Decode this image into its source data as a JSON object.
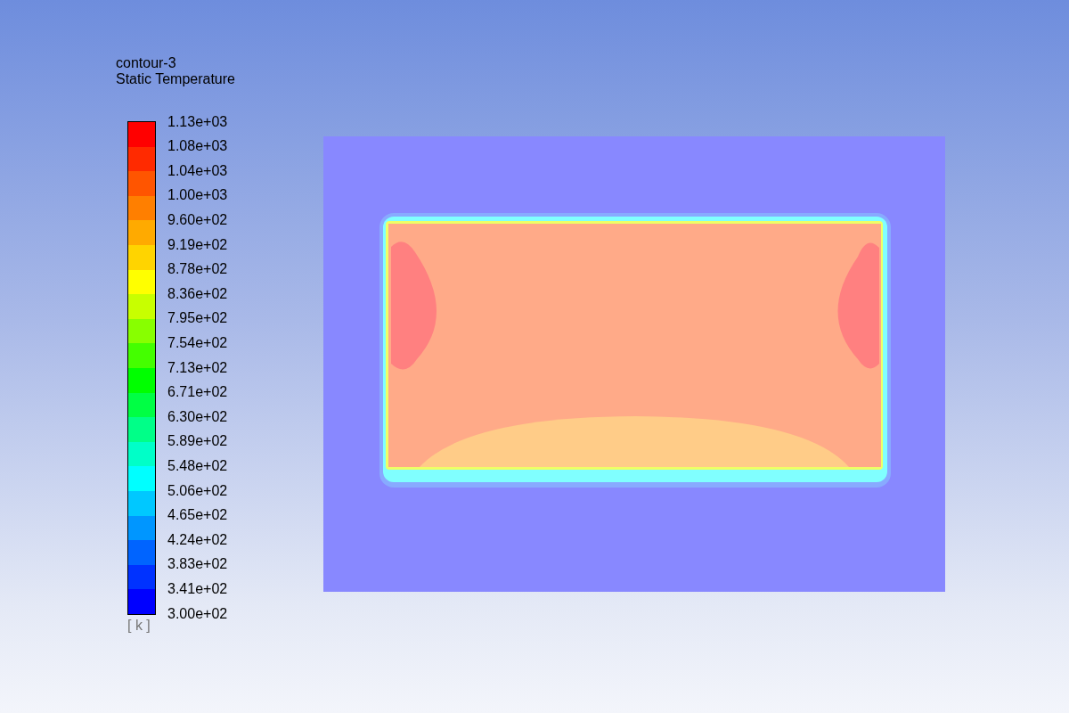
{
  "legend": {
    "title": "contour-3",
    "subtitle": "Static Temperature",
    "bands": [
      {
        "color": "#ff0000"
      },
      {
        "color": "#ff2a00"
      },
      {
        "color": "#ff5500"
      },
      {
        "color": "#ff7f00"
      },
      {
        "color": "#ffaa00"
      },
      {
        "color": "#ffd400"
      },
      {
        "color": "#ffff00"
      },
      {
        "color": "#c8ff00"
      },
      {
        "color": "#88ff00"
      },
      {
        "color": "#44ff00"
      },
      {
        "color": "#00ff00"
      },
      {
        "color": "#00ff44"
      },
      {
        "color": "#00ff88"
      },
      {
        "color": "#00ffc8"
      },
      {
        "color": "#00ffff"
      },
      {
        "color": "#00c8ff"
      },
      {
        "color": "#0096ff"
      },
      {
        "color": "#0064ff"
      },
      {
        "color": "#0032ff"
      },
      {
        "color": "#0000ff"
      }
    ],
    "labels": [
      "1.13e+03",
      "1.08e+03",
      "1.04e+03",
      "1.00e+03",
      "9.60e+02",
      "9.19e+02",
      "8.78e+02",
      "8.36e+02",
      "7.95e+02",
      "7.54e+02",
      "7.13e+02",
      "6.71e+02",
      "6.30e+02",
      "5.89e+02",
      "5.48e+02",
      "5.06e+02",
      "4.65e+02",
      "4.24e+02",
      "3.83e+02",
      "3.41e+02",
      "3.00e+02"
    ],
    "unit": "[ k ]"
  }
}
